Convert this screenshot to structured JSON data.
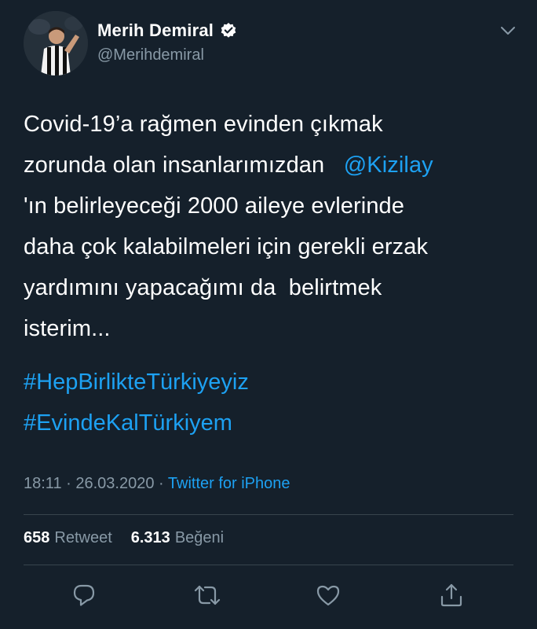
{
  "user": {
    "display_name": "Merih Demiral",
    "handle": "@Merihdemiral",
    "verified": true
  },
  "tweet": {
    "lines": [
      {
        "text": "Covid-19’a rağmen evinden çıkmak"
      },
      {
        "text": "zorunda olan insanlarımızdan   ",
        "mention": "@Kizilay"
      },
      {
        "text": "'ın belirleyeceği 2000 aileye evlerinde"
      },
      {
        "text": "daha çok kalabilmeleri için gerekli erzak"
      },
      {
        "text": "yardımını yapacağımı da  belirtmek"
      },
      {
        "text": "isterim..."
      }
    ],
    "hashtags": [
      "#HepBirlikteTürkiyeyiz",
      "#EvindeKalTürkiyem"
    ]
  },
  "meta": {
    "time": "18:11",
    "separator": " · ",
    "date": "26.03.2020",
    "source": "Twitter for iPhone"
  },
  "stats": {
    "retweets_count": "658",
    "retweets_label": "Retweet",
    "likes_count": "6.313",
    "likes_label": "Beğeni"
  },
  "icons": {
    "verified": "verified-badge-icon",
    "menu": "chevron-down-icon",
    "reply": "reply-icon",
    "retweet": "retweet-icon",
    "like": "heart-icon",
    "share": "share-icon"
  },
  "colors": {
    "background": "#15202b",
    "accent": "#1da1f2",
    "secondary_text": "#8899a6",
    "divider": "#38444d"
  }
}
